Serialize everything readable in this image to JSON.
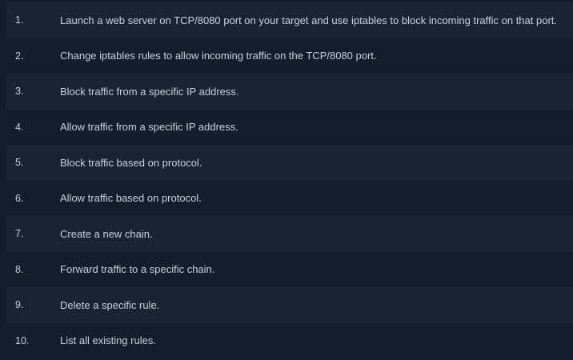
{
  "tasks": [
    {
      "number": "1.",
      "text": "Launch a web server on TCP/8080 port on your target and use iptables to block incoming traffic on that port."
    },
    {
      "number": "2.",
      "text": "Change iptables rules to allow incoming traffic on the TCP/8080 port."
    },
    {
      "number": "3.",
      "text": "Block traffic from a specific IP address."
    },
    {
      "number": "4.",
      "text": "Allow traffic from a specific IP address."
    },
    {
      "number": "5.",
      "text": "Block traffic based on protocol."
    },
    {
      "number": "6.",
      "text": "Allow traffic based on protocol."
    },
    {
      "number": "7.",
      "text": "Create a new chain."
    },
    {
      "number": "8.",
      "text": "Forward traffic to a specific chain."
    },
    {
      "number": "9.",
      "text": "Delete a specific rule."
    },
    {
      "number": "10.",
      "text": "List all existing rules."
    }
  ],
  "colors": {
    "background": "#141d2b",
    "row_alternate": "#1a2332",
    "text": "#c9d1dc"
  }
}
